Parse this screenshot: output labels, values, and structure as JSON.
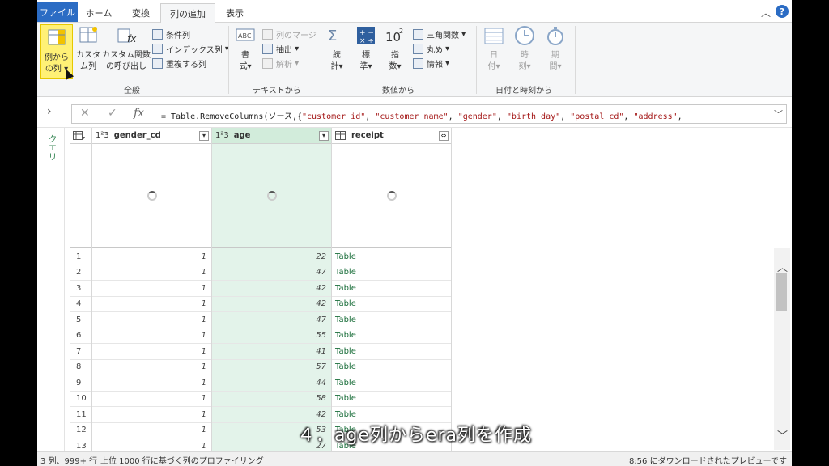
{
  "tabs": {
    "file": "ファイル",
    "home": "ホーム",
    "transform": "変換",
    "add_column": "列の追加",
    "view": "表示"
  },
  "ribbon": {
    "general": {
      "label": "全般",
      "example_col": [
        "例から",
        "の列"
      ],
      "custom_col": [
        "カスタ",
        "ム列"
      ],
      "custom_func": [
        "カスタム関数",
        "の呼び出し"
      ],
      "conditional": "条件列",
      "index": "インデックス列",
      "duplicate": "重複する列"
    },
    "text": {
      "label": "テキストから",
      "format": [
        "書",
        "式"
      ],
      "merge": "列のマージ",
      "extract": "抽出",
      "parse": "解析"
    },
    "number": {
      "label": "数値から",
      "statistics": [
        "統",
        "計"
      ],
      "standard": [
        "標",
        "準"
      ],
      "scientific": [
        "指",
        "数"
      ],
      "trig": "三角関数",
      "rounding": "丸め",
      "info": "情報"
    },
    "datetime": {
      "label": "日付と時刻から",
      "date": [
        "日",
        "付"
      ],
      "time": [
        "時",
        "刻"
      ],
      "duration": [
        "期",
        "間"
      ]
    }
  },
  "formula": {
    "prefix": "= Table.RemoveColumns(ソース,{",
    "args": [
      "\"customer_id\"",
      "\"customer_name\"",
      "\"gender\"",
      "\"birth_day\"",
      "\"postal_cd\"",
      "\"address\""
    ]
  },
  "queries_label": "クエリ",
  "grid": {
    "columns": [
      {
        "name": "gender_cd",
        "type": "1²3"
      },
      {
        "name": "age",
        "type": "1²3"
      },
      {
        "name": "receipt",
        "type": "table"
      }
    ],
    "rows": [
      {
        "n": "1",
        "gender": "1",
        "age": "22",
        "receipt": "Table"
      },
      {
        "n": "2",
        "gender": "1",
        "age": "47",
        "receipt": "Table"
      },
      {
        "n": "3",
        "gender": "1",
        "age": "42",
        "receipt": "Table"
      },
      {
        "n": "4",
        "gender": "1",
        "age": "42",
        "receipt": "Table"
      },
      {
        "n": "5",
        "gender": "1",
        "age": "47",
        "receipt": "Table"
      },
      {
        "n": "6",
        "gender": "1",
        "age": "55",
        "receipt": "Table"
      },
      {
        "n": "7",
        "gender": "1",
        "age": "41",
        "receipt": "Table"
      },
      {
        "n": "8",
        "gender": "1",
        "age": "57",
        "receipt": "Table"
      },
      {
        "n": "9",
        "gender": "1",
        "age": "44",
        "receipt": "Table"
      },
      {
        "n": "10",
        "gender": "1",
        "age": "58",
        "receipt": "Table"
      },
      {
        "n": "11",
        "gender": "1",
        "age": "42",
        "receipt": "Table"
      },
      {
        "n": "12",
        "gender": "1",
        "age": "53",
        "receipt": "Table"
      },
      {
        "n": "13",
        "gender": "1",
        "age": "27",
        "receipt": "Table"
      }
    ]
  },
  "status": {
    "cols_rows": "3 列、999+ 行",
    "profiling": "上位 1000 行に基づく列のプロファイリング",
    "download": "8:56 にダウンロードされたプレビューです"
  },
  "caption": "４．age列からera列を作成",
  "colors": {
    "accent": "#2b6cc4",
    "selected_col": "#e3f3ea",
    "highlight": "#fff176"
  }
}
